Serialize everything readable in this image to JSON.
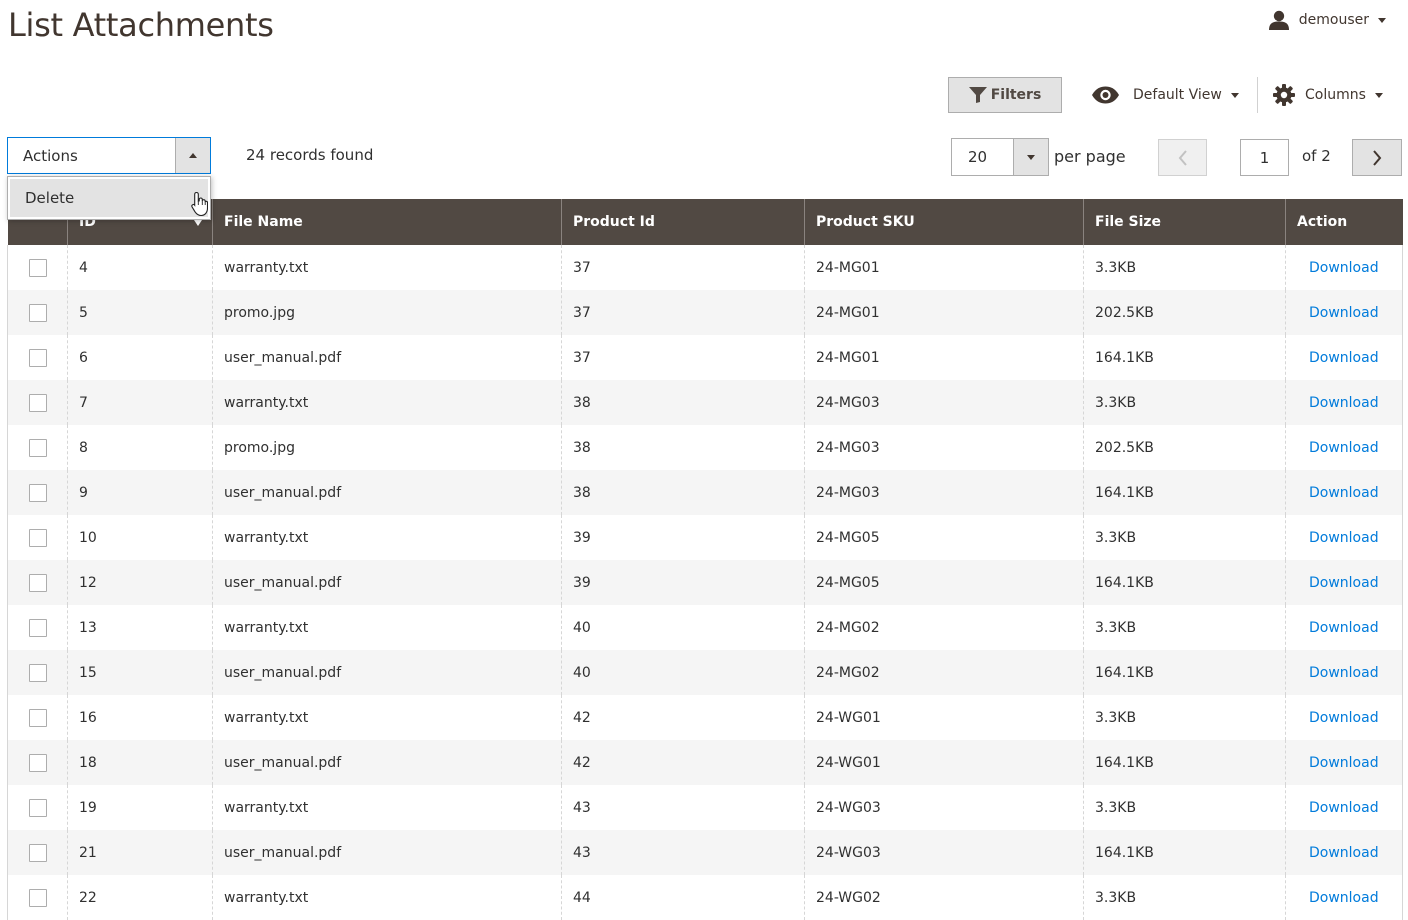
{
  "page": {
    "title": "List Attachments"
  },
  "user": {
    "name": "demouser"
  },
  "toolbar": {
    "filters_label": "Filters",
    "view_label": "Default View",
    "columns_label": "Columns"
  },
  "mass_actions": {
    "label": "Actions",
    "options": [
      "Delete"
    ]
  },
  "records": {
    "found_text": "24 records found"
  },
  "pagination": {
    "per_page_value": "20",
    "per_page_label": "per page",
    "current_page": "1",
    "of_text": "of 2"
  },
  "grid": {
    "columns": [
      "ID",
      "File Name",
      "Product Id",
      "Product SKU",
      "File Size",
      "Action"
    ],
    "rows": [
      {
        "id": "4",
        "file": "warranty.txt",
        "product_id": "37",
        "sku": "24-MG01",
        "size": "3.3KB",
        "action": "Download"
      },
      {
        "id": "5",
        "file": "promo.jpg",
        "product_id": "37",
        "sku": "24-MG01",
        "size": "202.5KB",
        "action": "Download"
      },
      {
        "id": "6",
        "file": "user_manual.pdf",
        "product_id": "37",
        "sku": "24-MG01",
        "size": "164.1KB",
        "action": "Download"
      },
      {
        "id": "7",
        "file": "warranty.txt",
        "product_id": "38",
        "sku": "24-MG03",
        "size": "3.3KB",
        "action": "Download"
      },
      {
        "id": "8",
        "file": "promo.jpg",
        "product_id": "38",
        "sku": "24-MG03",
        "size": "202.5KB",
        "action": "Download"
      },
      {
        "id": "9",
        "file": "user_manual.pdf",
        "product_id": "38",
        "sku": "24-MG03",
        "size": "164.1KB",
        "action": "Download"
      },
      {
        "id": "10",
        "file": "warranty.txt",
        "product_id": "39",
        "sku": "24-MG05",
        "size": "3.3KB",
        "action": "Download"
      },
      {
        "id": "12",
        "file": "user_manual.pdf",
        "product_id": "39",
        "sku": "24-MG05",
        "size": "164.1KB",
        "action": "Download"
      },
      {
        "id": "13",
        "file": "warranty.txt",
        "product_id": "40",
        "sku": "24-MG02",
        "size": "3.3KB",
        "action": "Download"
      },
      {
        "id": "15",
        "file": "user_manual.pdf",
        "product_id": "40",
        "sku": "24-MG02",
        "size": "164.1KB",
        "action": "Download"
      },
      {
        "id": "16",
        "file": "warranty.txt",
        "product_id": "42",
        "sku": "24-WG01",
        "size": "3.3KB",
        "action": "Download"
      },
      {
        "id": "18",
        "file": "user_manual.pdf",
        "product_id": "42",
        "sku": "24-WG01",
        "size": "164.1KB",
        "action": "Download"
      },
      {
        "id": "19",
        "file": "warranty.txt",
        "product_id": "43",
        "sku": "24-WG03",
        "size": "3.3KB",
        "action": "Download"
      },
      {
        "id": "21",
        "file": "user_manual.pdf",
        "product_id": "43",
        "sku": "24-WG03",
        "size": "164.1KB",
        "action": "Download"
      },
      {
        "id": "22",
        "file": "warranty.txt",
        "product_id": "44",
        "sku": "24-WG02",
        "size": "3.3KB",
        "action": "Download"
      }
    ]
  },
  "icons": {
    "user": "user-icon",
    "filter": "funnel-icon",
    "view": "eye-icon",
    "columns": "gear-icon",
    "prev": "chevron-left-icon",
    "next": "chevron-right-icon",
    "cursor": "hand-pointer-icon"
  },
  "colors": {
    "header_bg": "#514943",
    "link": "#007bdb",
    "focus_border": "#007bdb",
    "button_bg": "#e3e3e3"
  }
}
